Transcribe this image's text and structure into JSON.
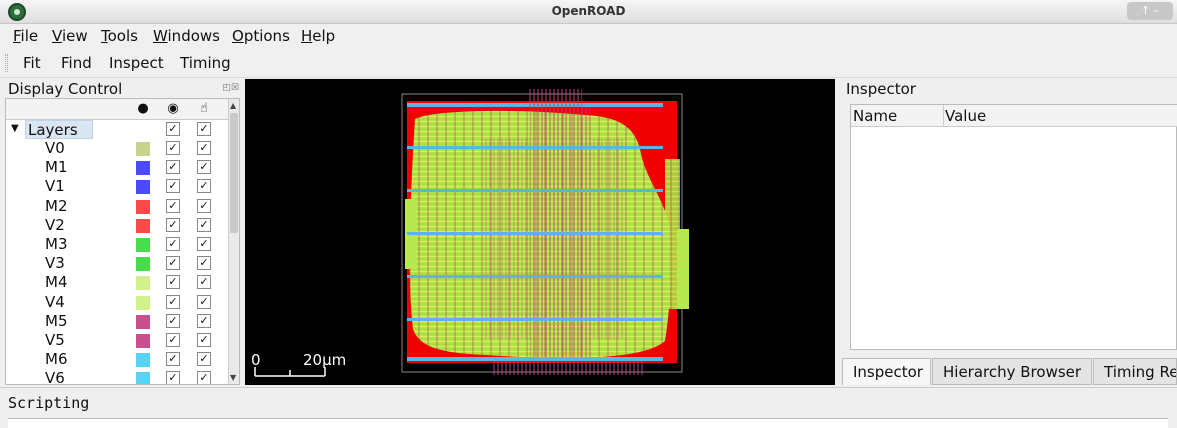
{
  "window": {
    "title": "OpenROAD"
  },
  "menu": [
    "File",
    "View",
    "Tools",
    "Windows",
    "Options",
    "Help"
  ],
  "toolbar": [
    "Fit",
    "Find",
    "Inspect",
    "Timing"
  ],
  "display_control": {
    "title": "Display Control",
    "columns": [
      "palette-icon",
      "eye-icon",
      "pointer-icon"
    ],
    "root_label": "Layers",
    "layers": [
      {
        "name": "V0",
        "color": "#c8d48c"
      },
      {
        "name": "M1",
        "color": "#4b4bfa"
      },
      {
        "name": "V1",
        "color": "#4b4bfa"
      },
      {
        "name": "M2",
        "color": "#fa4b4b"
      },
      {
        "name": "V2",
        "color": "#fa4b4b"
      },
      {
        "name": "M3",
        "color": "#4bdc4b"
      },
      {
        "name": "V3",
        "color": "#4bdc4b"
      },
      {
        "name": "M4",
        "color": "#d2f08c"
      },
      {
        "name": "V4",
        "color": "#d2f08c"
      },
      {
        "name": "M5",
        "color": "#c8508c"
      },
      {
        "name": "V5",
        "color": "#c8508c"
      },
      {
        "name": "M6",
        "color": "#5ad2f5"
      },
      {
        "name": "V6",
        "color": "#5ad2f5"
      }
    ],
    "check_mark": "✓"
  },
  "layout_view": {
    "scale_start": "0",
    "scale_label": "20μm"
  },
  "inspector": {
    "title": "Inspector",
    "col_name": "Name",
    "col_value": "Value",
    "tabs": [
      "Inspector",
      "Hierarchy Browser",
      "Timing Re"
    ]
  },
  "scripting": {
    "title": "Scripting"
  }
}
